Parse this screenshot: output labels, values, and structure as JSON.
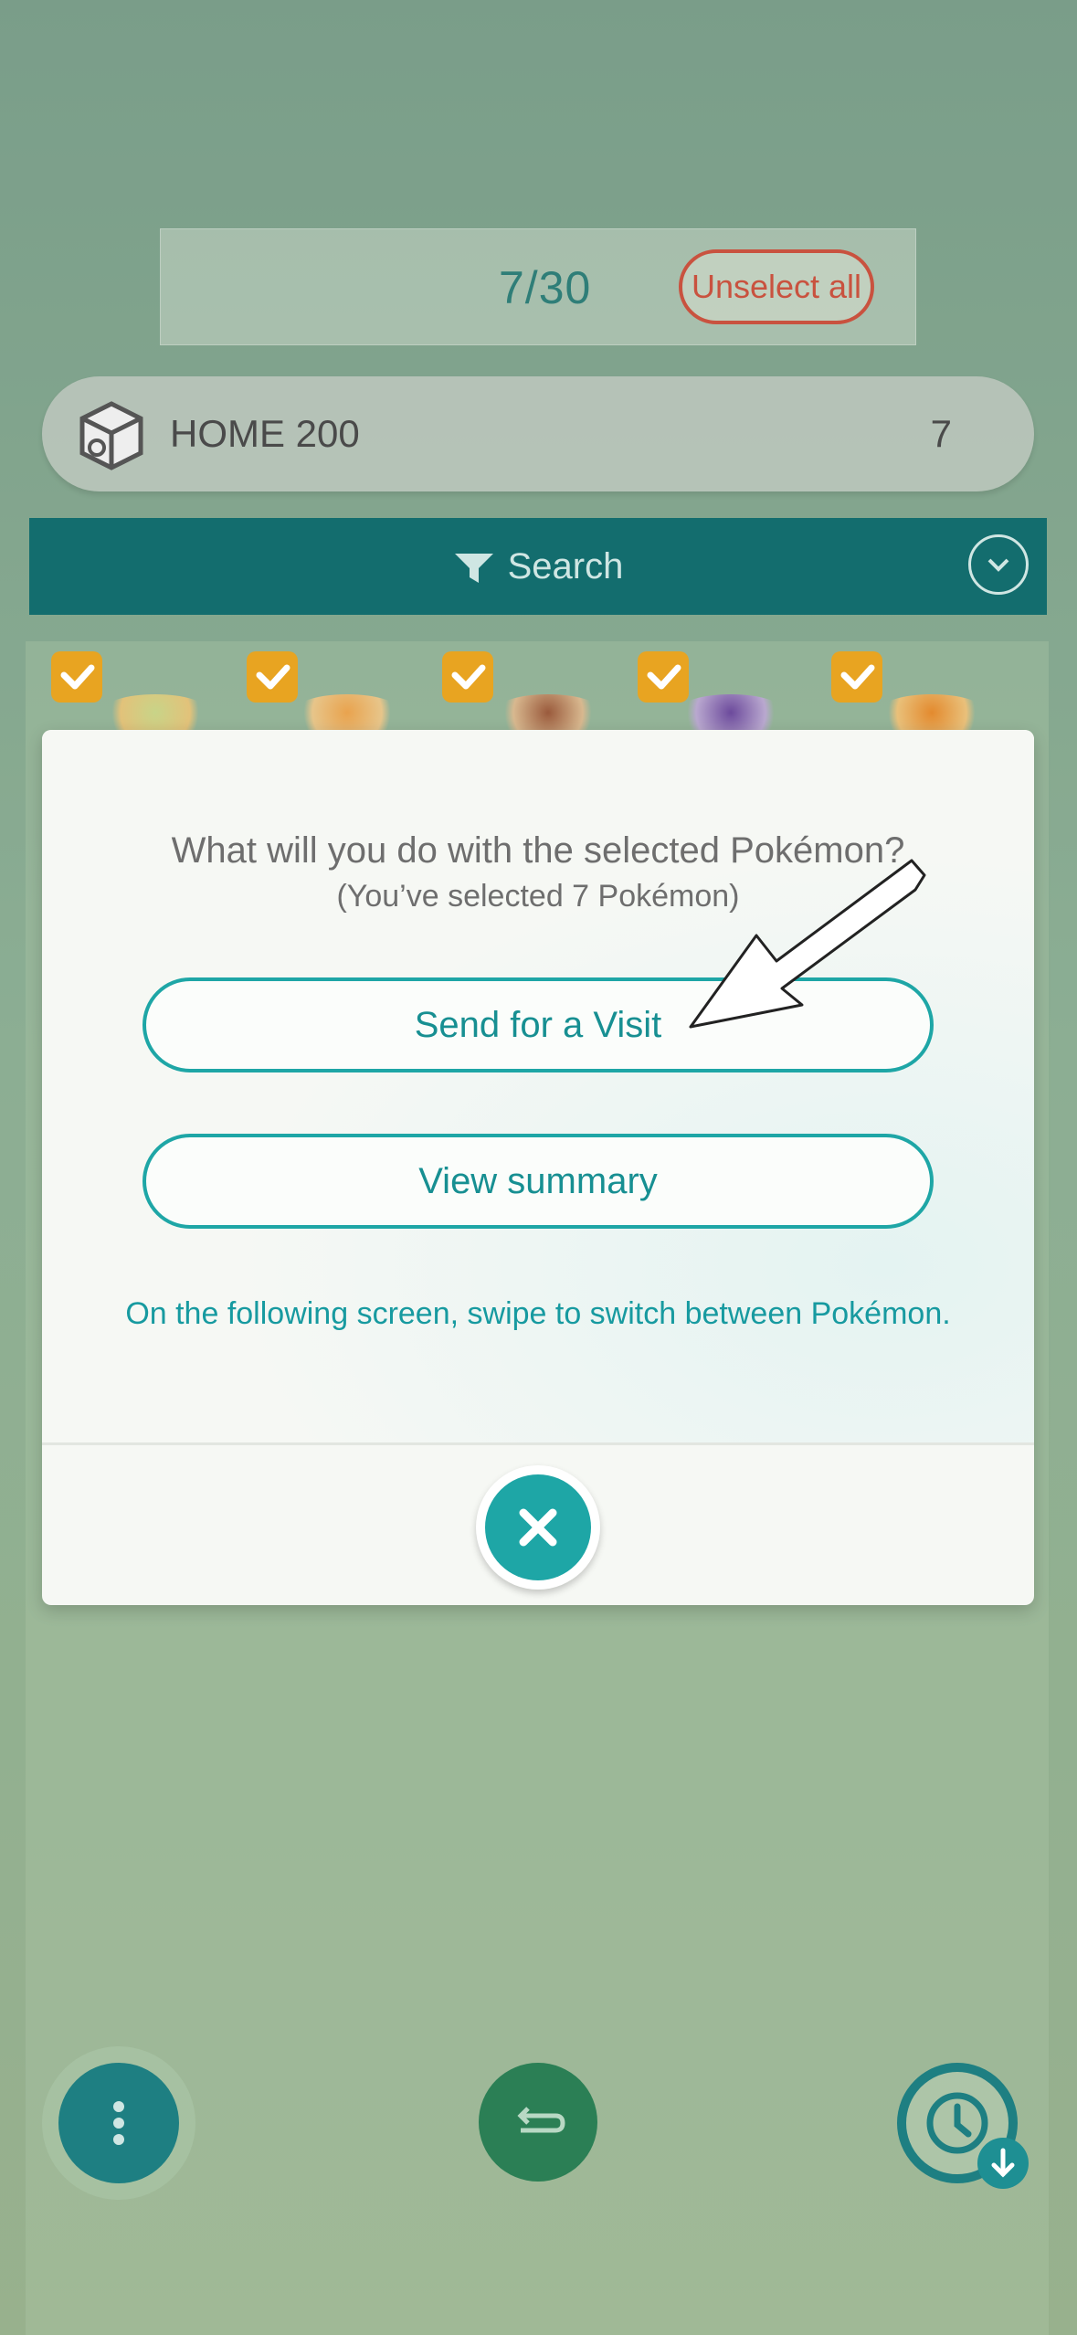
{
  "selection": {
    "count": "7/30",
    "unselect_label": "Unselect all"
  },
  "box": {
    "icon": "box-icon",
    "name": "HOME 200",
    "count": "7"
  },
  "search": {
    "label": "Search",
    "icon": "funnel-icon",
    "toggle_icon": "chevron-down-icon"
  },
  "grid": {
    "selected_slots": 5,
    "check_color": "#e8a421"
  },
  "dialog": {
    "question": "What will you do with the selected Pokémon?",
    "subtitle": "(You’ve selected 7 Pokémon)",
    "send_label": "Send for a Visit",
    "summary_label": "View summary",
    "hint": "On the following screen, swipe to switch between Pokémon.",
    "close_icon": "close-icon"
  },
  "bottom": {
    "menu_icon": "more-vertical-icon",
    "back_icon": "return-icon",
    "history_icon": "clock-icon",
    "history_badge_icon": "arrow-down-icon"
  },
  "colors": {
    "accent": "#1ea6a6",
    "search_bar": "#136d6e",
    "unselect": "#c9523f"
  }
}
